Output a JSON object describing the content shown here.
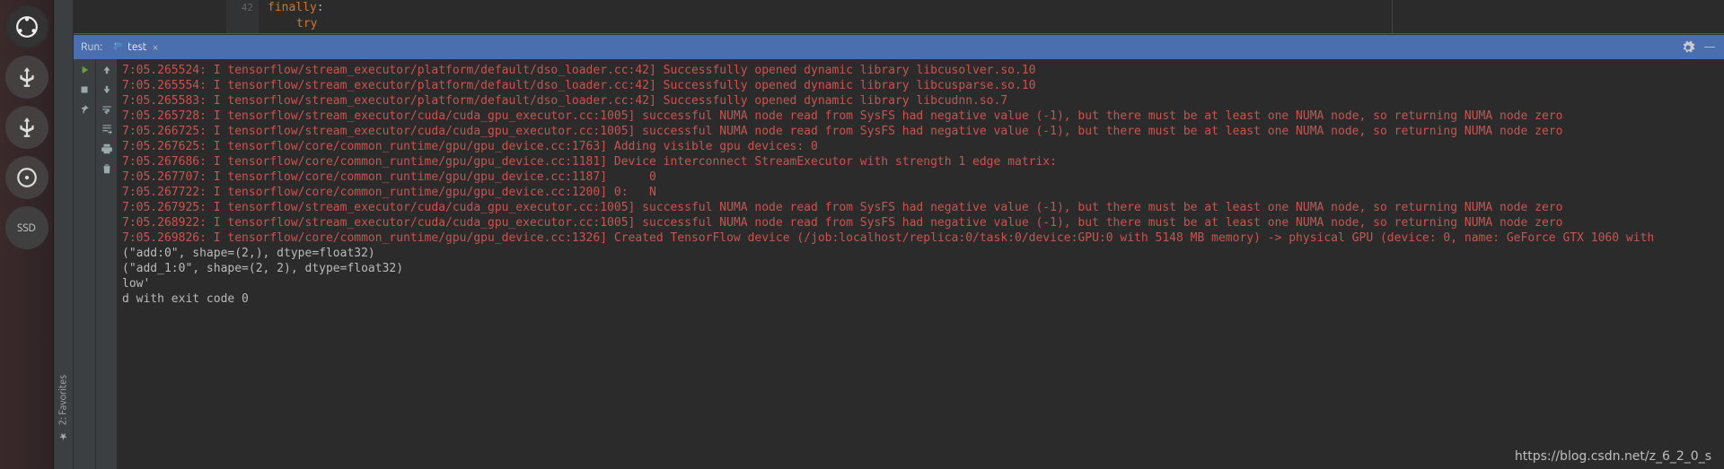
{
  "launcher": {
    "items": [
      {
        "name": "ubuntu",
        "label": "Ubuntu"
      },
      {
        "name": "usb1",
        "label": "USB"
      },
      {
        "name": "usb2",
        "label": "USB"
      },
      {
        "name": "disk",
        "label": "Disk"
      },
      {
        "name": "ssd",
        "label": "SSD"
      }
    ]
  },
  "sidestrip": {
    "favorites_label": "2: Favorites"
  },
  "editor": {
    "line_number": "42",
    "code_kw_finally": "finally",
    "code_colon": ":",
    "code_try": "try"
  },
  "run": {
    "label": "Run:",
    "tab_name": "test"
  },
  "console": {
    "lines": [
      {
        "cls": "stderr",
        "text": "7:05.265524: I tensorflow/stream_executor/platform/default/dso_loader.cc:42] Successfully opened dynamic library libcusolver.so.10"
      },
      {
        "cls": "stderr",
        "text": "7:05.265554: I tensorflow/stream_executor/platform/default/dso_loader.cc:42] Successfully opened dynamic library libcusparse.so.10"
      },
      {
        "cls": "stderr",
        "text": "7:05.265583: I tensorflow/stream_executor/platform/default/dso_loader.cc:42] Successfully opened dynamic library libcudnn.so.7"
      },
      {
        "cls": "stderr",
        "text": "7:05.265728: I tensorflow/stream_executor/cuda/cuda_gpu_executor.cc:1005] successful NUMA node read from SysFS had negative value (-1), but there must be at least one NUMA node, so returning NUMA node zero"
      },
      {
        "cls": "stderr",
        "text": "7:05.266725: I tensorflow/stream_executor/cuda/cuda_gpu_executor.cc:1005] successful NUMA node read from SysFS had negative value (-1), but there must be at least one NUMA node, so returning NUMA node zero"
      },
      {
        "cls": "stderr",
        "text": "7:05.267625: I tensorflow/core/common_runtime/gpu/gpu_device.cc:1763] Adding visible gpu devices: 0"
      },
      {
        "cls": "stderr",
        "text": "7:05.267686: I tensorflow/core/common_runtime/gpu/gpu_device.cc:1181] Device interconnect StreamExecutor with strength 1 edge matrix:"
      },
      {
        "cls": "stderr",
        "text": "7:05.267707: I tensorflow/core/common_runtime/gpu/gpu_device.cc:1187]      0"
      },
      {
        "cls": "stderr",
        "text": "7:05.267722: I tensorflow/core/common_runtime/gpu/gpu_device.cc:1200] 0:   N"
      },
      {
        "cls": "stderr",
        "text": "7:05.267925: I tensorflow/stream_executor/cuda/cuda_gpu_executor.cc:1005] successful NUMA node read from SysFS had negative value (-1), but there must be at least one NUMA node, so returning NUMA node zero"
      },
      {
        "cls": "stderr",
        "text": "7:05.268922: I tensorflow/stream_executor/cuda/cuda_gpu_executor.cc:1005] successful NUMA node read from SysFS had negative value (-1), but there must be at least one NUMA node, so returning NUMA node zero"
      },
      {
        "cls": "stderr",
        "text": "7:05.269826: I tensorflow/core/common_runtime/gpu/gpu_device.cc:1326] Created TensorFlow device (/job:localhost/replica:0/task:0/device:GPU:0 with 5148 MB memory) -> physical GPU (device: 0, name: GeForce GTX 1060 with"
      },
      {
        "cls": "stdout",
        "text": "(\"add:0\", shape=(2,), dtype=float32)"
      },
      {
        "cls": "stdout",
        "text": ""
      },
      {
        "cls": "stdout",
        "text": "(\"add_1:0\", shape=(2, 2), dtype=float32)"
      },
      {
        "cls": "stdout",
        "text": ""
      },
      {
        "cls": "stdout",
        "text": ""
      },
      {
        "cls": "stdout",
        "text": "low'"
      },
      {
        "cls": "stdout",
        "text": ""
      },
      {
        "cls": "stdout",
        "text": "d with exit code 0"
      }
    ]
  },
  "watermark": "https://blog.csdn.net/z_6_2_0_s"
}
